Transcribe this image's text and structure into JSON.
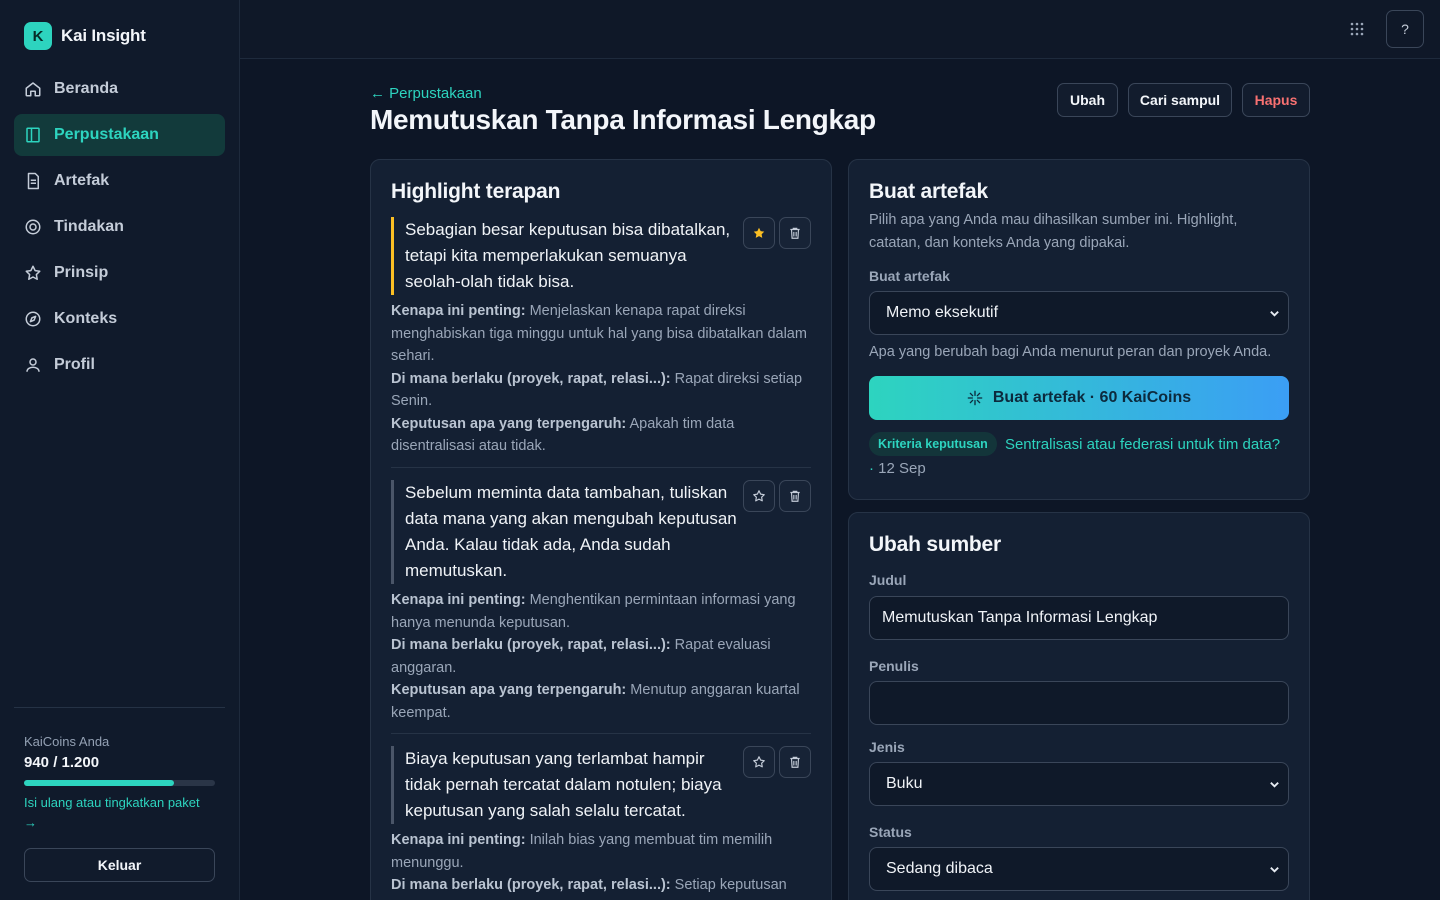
{
  "app": {
    "name": "Kai Insight",
    "logo_letter": "K"
  },
  "sidebar": {
    "items": [
      {
        "label": "Beranda",
        "icon": "home-icon"
      },
      {
        "label": "Perpustakaan",
        "icon": "book-icon",
        "active": true
      },
      {
        "label": "Artefak",
        "icon": "document-icon"
      },
      {
        "label": "Tindakan",
        "icon": "target-icon"
      },
      {
        "label": "Prinsip",
        "icon": "star-icon"
      },
      {
        "label": "Konteks",
        "icon": "compass-icon"
      },
      {
        "label": "Profil",
        "icon": "user-icon"
      }
    ],
    "coins_label": "KaiCoins Anda",
    "coins_value": "940 / 1.200",
    "coins_fraction": 0.783,
    "coins_link": "Isi ulang atau tingkatkan paket →",
    "logout_label": "Keluar"
  },
  "topbar": {
    "help_label": "?"
  },
  "header": {
    "back_label": "← Perpustakaan",
    "title": "Memutuskan Tanpa Informasi Lengkap",
    "edit_label": "Ubah",
    "cover_label": "Cari sampul",
    "delete_label": "Hapus"
  },
  "highlights": {
    "title": "Highlight terapan",
    "label_why": "Kenapa ini penting:",
    "label_where": "Di mana berlaku (proyek, rapat, relasi...):",
    "label_decision": "Keputusan apa yang terpengaruh:",
    "items": [
      {
        "quote": "Sebagian besar keputusan bisa dibatalkan, tetapi kita memperlakukan semuanya seolah-olah tidak bisa.",
        "starred": true,
        "why": "Menjelaskan kenapa rapat direksi menghabiskan tiga minggu untuk hal yang bisa dibatalkan dalam sehari.",
        "where": "Rapat direksi setiap Senin.",
        "decision": "Apakah tim data disentralisasi atau tidak."
      },
      {
        "quote": "Sebelum meminta data tambahan, tuliskan data mana yang akan mengubah keputusan Anda. Kalau tidak ada, Anda sudah memutuskan.",
        "starred": false,
        "why": "Menghentikan permintaan informasi yang hanya menunda keputusan.",
        "where": "Rapat evaluasi anggaran.",
        "decision": "Menutup anggaran kuartal keempat."
      },
      {
        "quote": "Biaya keputusan yang terlambat hampir tidak pernah tercatat dalam notulen; biaya keputusan yang salah selalu tercatat.",
        "starred": false,
        "why": "Inilah bias yang membuat tim memilih menunggu.",
        "where": "Setiap keputusan"
      }
    ]
  },
  "artifact": {
    "title": "Buat artefak",
    "description": "Pilih apa yang Anda mau dihasilkan sumber ini. Highlight, catatan, dan konteks Anda yang dipakai.",
    "select_label": "Buat artefak",
    "select_value": "Memo eksekutif",
    "hint": "Apa yang berubah bagi Anda menurut peran dan proyek Anda.",
    "cta_label": "Buat artefak · 60 KaiCoins",
    "recent_tag": "Kriteria keputusan",
    "recent_text": "Sentralisasi atau federasi untuk tim data? ·",
    "recent_date": "12 Sep"
  },
  "source": {
    "title": "Ubah sumber",
    "title_label": "Judul",
    "title_value": "Memutuskan Tanpa Informasi Lengkap",
    "author_label": "Penulis",
    "author_value": "",
    "type_label": "Jenis",
    "type_value": "Buku",
    "status_label": "Status",
    "status_value": "Sedang dibaca"
  },
  "colors": {
    "accent": "#2dd4bf",
    "danger": "#f87171",
    "star": "#fbbf24",
    "background": "#0d1626"
  }
}
